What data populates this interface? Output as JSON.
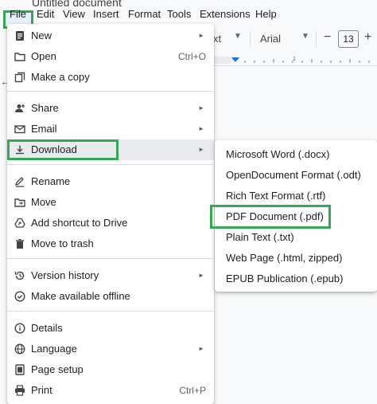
{
  "document": {
    "title": "Untitled document"
  },
  "menubar": {
    "items": [
      "File",
      "Edit",
      "View",
      "Insert",
      "Format",
      "Tools",
      "Extensions",
      "Help"
    ],
    "highlight_color": "#34a853"
  },
  "toolbar": {
    "style_partial": "xt",
    "font": "Arial",
    "font_size": "13"
  },
  "file_menu": {
    "items": [
      {
        "label": "New",
        "icon": "document-icon",
        "submenu": true
      },
      {
        "label": "Open",
        "icon": "folder-icon",
        "shortcut": "Ctrl+O"
      },
      {
        "label": "Make a copy",
        "icon": "copy-icon"
      },
      {
        "label": "Share",
        "icon": "share-person-icon",
        "submenu": true
      },
      {
        "label": "Email",
        "icon": "email-icon",
        "submenu": true
      },
      {
        "label": "Download",
        "icon": "download-icon",
        "submenu": true,
        "active": true
      },
      {
        "label": "Rename",
        "icon": "rename-icon"
      },
      {
        "label": "Move",
        "icon": "move-folder-icon"
      },
      {
        "label": "Add shortcut to Drive",
        "icon": "drive-shortcut-icon"
      },
      {
        "label": "Move to trash",
        "icon": "trash-icon"
      },
      {
        "label": "Version history",
        "icon": "history-icon",
        "submenu": true
      },
      {
        "label": "Make available offline",
        "icon": "offline-icon"
      },
      {
        "label": "Details",
        "icon": "info-icon"
      },
      {
        "label": "Language",
        "icon": "globe-icon",
        "submenu": true
      },
      {
        "label": "Page setup",
        "icon": "page-setup-icon"
      },
      {
        "label": "Print",
        "icon": "print-icon",
        "shortcut": "Ctrl+P"
      }
    ]
  },
  "download_submenu": {
    "items": [
      "Microsoft Word (.docx)",
      "OpenDocument Format (.odt)",
      "Rich Text Format (.rtf)",
      "PDF Document (.pdf)",
      "Plain Text (.txt)",
      "Web Page (.html, zipped)",
      "EPUB Publication (.epub)"
    ],
    "highlighted": "PDF Document (.pdf)"
  },
  "colors": {
    "accent": "#34a853",
    "menu_hover": "#e8eaed",
    "ruler_marker": "#1a73e8"
  }
}
